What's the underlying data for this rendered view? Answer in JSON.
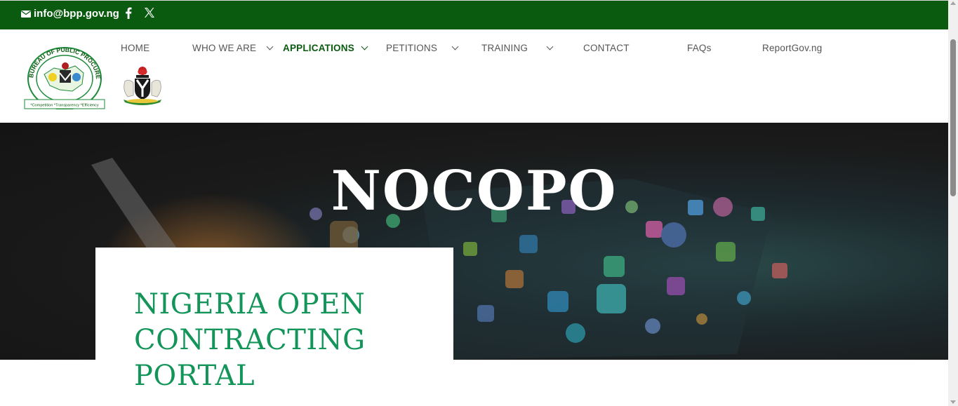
{
  "topbar": {
    "email": "info@bpp.gov.ng",
    "icons": [
      "mail-icon",
      "facebook-icon",
      "x-twitter-icon"
    ],
    "bg_color": "#0a5a10"
  },
  "header": {
    "logos": {
      "bpp_ring_text": "BUREAU OF PUBLIC PROCUREMENT",
      "bpp_tagline": "*Competition *Transparency *Efficiency"
    },
    "nav": [
      {
        "label": "HOME",
        "has_dropdown": false
      },
      {
        "label": "WHO WE ARE",
        "has_dropdown": true
      },
      {
        "label": "APPLICATIONS",
        "has_dropdown": true,
        "active": true
      },
      {
        "label": "PETITIONS",
        "has_dropdown": true
      },
      {
        "label": "TRAINING",
        "has_dropdown": true
      },
      {
        "label": "CONTACT",
        "has_dropdown": false
      },
      {
        "label": "FAQs",
        "has_dropdown": false
      },
      {
        "label": "ReportGov.ng",
        "has_dropdown": false
      }
    ]
  },
  "hero": {
    "title": "NOCOPO"
  },
  "card": {
    "title": "NIGERIA OPEN CONTRACTING PORTAL",
    "accent_color": "#13955a"
  }
}
